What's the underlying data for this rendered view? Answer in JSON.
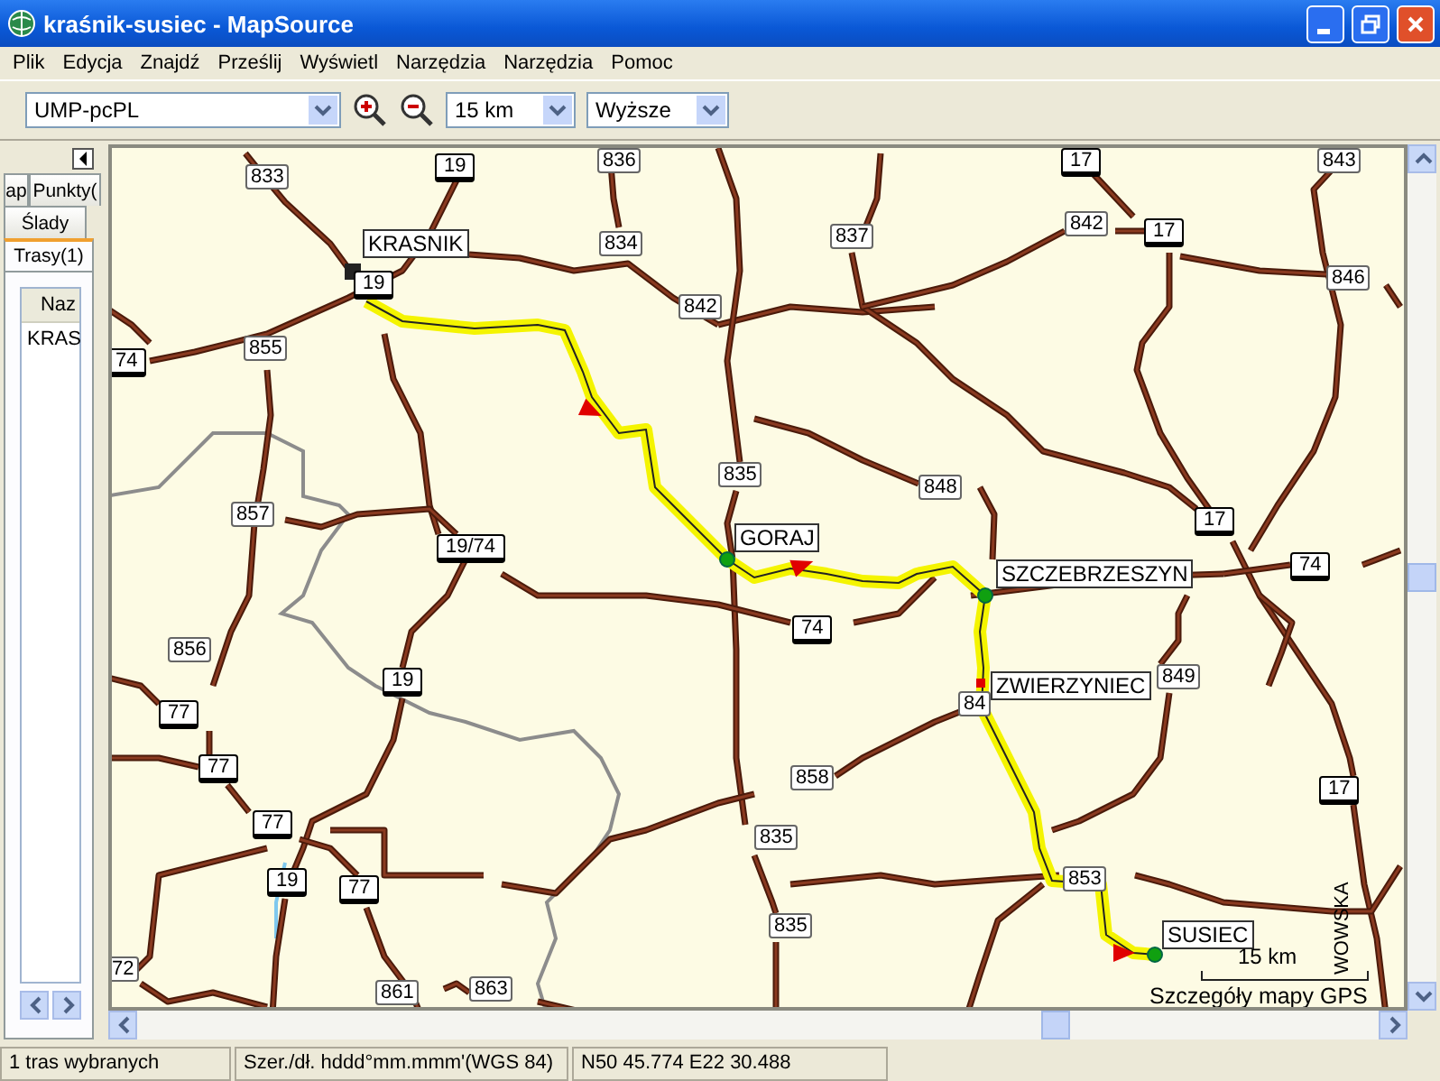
{
  "window": {
    "title": "kraśnik-susiec - MapSource"
  },
  "menu": [
    "Plik",
    "Edycja",
    "Znajdź",
    "Prześlij",
    "Wyświetl",
    "Narzędzia",
    "Narzędzia",
    "Pomoc"
  ],
  "toolbar": {
    "map_product": "UMP-pcPL",
    "zoom_level": "15 km",
    "detail": "Wyższe"
  },
  "sidebar": {
    "tabs": [
      {
        "label": "ap",
        "selected": false
      },
      {
        "label": "Punkty(",
        "selected": false
      },
      {
        "label": "Ślady",
        "selected": false
      },
      {
        "label": "Trasy(1)",
        "selected": true
      }
    ],
    "list": {
      "column": "Naz",
      "rows": [
        "KRAS"
      ]
    }
  },
  "map": {
    "road_labels": [
      {
        "kind": "regional",
        "text": "833"
      },
      {
        "kind": "national",
        "text": "19"
      },
      {
        "kind": "regional",
        "text": "836"
      },
      {
        "kind": "regional",
        "text": "834"
      },
      {
        "kind": "regional",
        "text": "837"
      },
      {
        "kind": "regional",
        "text": "842"
      },
      {
        "kind": "national",
        "text": "17"
      },
      {
        "kind": "regional",
        "text": "842"
      },
      {
        "kind": "national",
        "text": "17"
      },
      {
        "kind": "regional",
        "text": "843"
      },
      {
        "kind": "regional",
        "text": "846"
      },
      {
        "kind": "national",
        "text": "19"
      },
      {
        "kind": "regional",
        "text": "855"
      },
      {
        "kind": "national",
        "text": "74"
      },
      {
        "kind": "regional",
        "text": "835"
      },
      {
        "kind": "regional",
        "text": "848"
      },
      {
        "kind": "regional",
        "text": "857"
      },
      {
        "kind": "national",
        "text": "19/74"
      },
      {
        "kind": "national",
        "text": "17"
      },
      {
        "kind": "national",
        "text": "74"
      },
      {
        "kind": "national",
        "text": "74"
      },
      {
        "kind": "regional",
        "text": "856"
      },
      {
        "kind": "national",
        "text": "19"
      },
      {
        "kind": "national",
        "text": "77"
      },
      {
        "kind": "regional",
        "text": "849"
      },
      {
        "kind": "regional",
        "text": "84"
      },
      {
        "kind": "national",
        "text": "77"
      },
      {
        "kind": "regional",
        "text": "858"
      },
      {
        "kind": "national",
        "text": "77"
      },
      {
        "kind": "regional",
        "text": "835"
      },
      {
        "kind": "national",
        "text": "19"
      },
      {
        "kind": "national",
        "text": "77"
      },
      {
        "kind": "regional",
        "text": "853"
      },
      {
        "kind": "regional",
        "text": "835"
      },
      {
        "kind": "regional",
        "text": "72"
      },
      {
        "kind": "regional",
        "text": "861"
      },
      {
        "kind": "regional",
        "text": "863"
      },
      {
        "kind": "national",
        "text": "17"
      }
    ],
    "places": [
      "KRASNIK",
      "GORAJ",
      "SZCZEBRZESZYN",
      "ZWIERZYNIEC",
      "SUSIEC"
    ],
    "street": "WOWSKA",
    "scale": "15 km",
    "detail_note": "Szczegóły mapy GPS"
  },
  "status_bar": [
    "1 tras wybranych",
    "Szer./dł. hddd°mm.mmm'(WGS 84)",
    "N50 45.774 E22 30.488"
  ]
}
